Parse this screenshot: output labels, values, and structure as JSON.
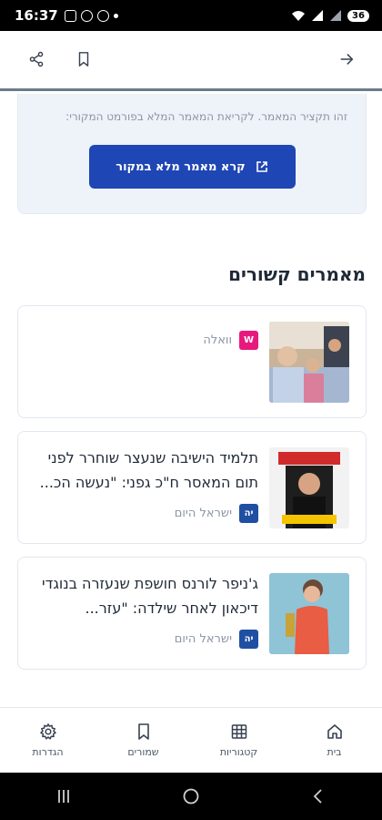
{
  "status_bar": {
    "time": "16:37",
    "battery": "36"
  },
  "header": {
    "share_icon": "share-icon",
    "bookmark_icon": "bookmark-icon",
    "forward_icon": "arrow-right-icon"
  },
  "summary": {
    "note": "זהו תקציר המאמר. לקריאת המאמר המלא בפורמט המקורי:",
    "button_label": "קרא מאמר מלא במקור",
    "button_icon": "external-link-icon"
  },
  "related": {
    "title": "מאמרים קשורים",
    "articles": [
      {
        "title": "",
        "source": "וואלה",
        "badge": "W",
        "badge_color": "#e7197e"
      },
      {
        "title": "תלמיד הישיבה שנעצר שוחרר לפני תום המאסר ח\"כ גפני: \"נעשה הכ...",
        "source": "ישראל היום",
        "badge": "יה",
        "badge_color": "#1e4fa3"
      },
      {
        "title": "ג'ניפר לורנס חושפת שנעזרה בנוגדי דיכאון לאחר שילדה: \"עזר...",
        "source": "ישראל היום",
        "badge": "יה",
        "badge_color": "#1e4fa3"
      }
    ]
  },
  "bottom_nav": {
    "items": [
      {
        "label": "בית",
        "icon": "home-icon"
      },
      {
        "label": "קטגוריות",
        "icon": "grid-icon"
      },
      {
        "label": "שמורים",
        "icon": "bookmark-icon"
      },
      {
        "label": "הגדרות",
        "icon": "gear-icon"
      }
    ]
  },
  "colors": {
    "accent": "#1e46b4",
    "summary_bg": "#eef2f9",
    "header_border": "#6b7b8c"
  }
}
